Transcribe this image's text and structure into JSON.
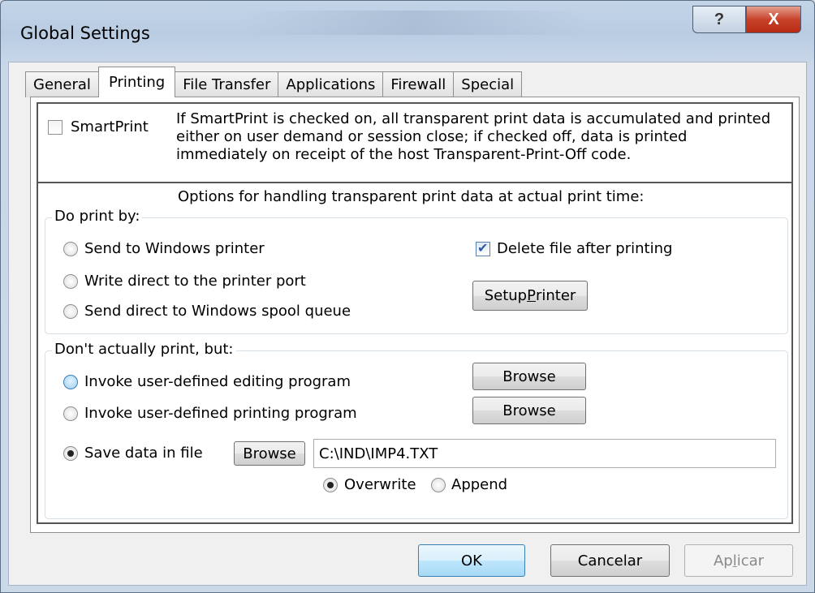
{
  "window": {
    "title": "Global Settings",
    "help_label": "?",
    "close_label": "X"
  },
  "tabs": [
    {
      "label": "General"
    },
    {
      "label": "Printing",
      "active": true
    },
    {
      "label": "File Transfer"
    },
    {
      "label": "Applications"
    },
    {
      "label": "Firewall"
    },
    {
      "label": "Special"
    }
  ],
  "smartprint": {
    "label": "SmartPrint",
    "checked": false,
    "description": "If SmartPrint is checked on, all transparent print data is accumulated and printed either on user demand or session close;  if checked off, data is printed immediately on receipt of the host Transparent-Print-Off code."
  },
  "options_heading": "Options for handling transparent print data at actual print time:",
  "do_print": {
    "legend": "Do print by:",
    "options": [
      {
        "label": "Send to Windows printer",
        "selected": false
      },
      {
        "label": "Write direct to the printer port",
        "selected": false
      },
      {
        "label": "Send direct to Windows spool queue",
        "selected": false
      }
    ],
    "delete_after": {
      "label": "Delete file after printing",
      "checked": true
    },
    "setup_printer_pre": "Setup ",
    "setup_printer_u": "P",
    "setup_printer_post": "rinter"
  },
  "dont_print": {
    "legend": "Don't actually print, but:",
    "options": [
      {
        "label": "Invoke user-defined editing program",
        "selected": false
      },
      {
        "label": "Invoke user-defined printing program",
        "selected": false
      },
      {
        "label": "Save data in file",
        "selected": true
      }
    ],
    "browse_label": "Browse",
    "file_path": "C:\\IND\\IMP4.TXT",
    "overwrite_label": "Overwrite",
    "append_label": "Append",
    "mode": "overwrite"
  },
  "footer": {
    "ok_label": "OK",
    "cancel_label": "Cancelar",
    "apply_pre": "Ap",
    "apply_u": "l",
    "apply_post": "icar"
  }
}
